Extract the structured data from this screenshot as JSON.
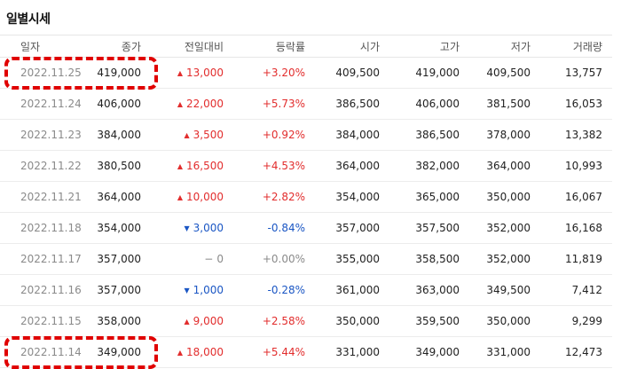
{
  "title": "일별시세",
  "columns": [
    "일자",
    "종가",
    "전일대비",
    "등락률",
    "시가",
    "고가",
    "저가",
    "거래량"
  ],
  "colors": {
    "up": "#e22d2d",
    "down": "#1a56c4",
    "flat": "#8a8a8a",
    "highlight": "#e00000"
  },
  "rows": [
    {
      "date": "2022.11.25",
      "close": "419,000",
      "dir": "up",
      "change": "13,000",
      "rate": "+3.20%",
      "open": "409,500",
      "high": "419,000",
      "low": "409,500",
      "volume": "13,757",
      "highlighted": true
    },
    {
      "date": "2022.11.24",
      "close": "406,000",
      "dir": "up",
      "change": "22,000",
      "rate": "+5.73%",
      "open": "386,500",
      "high": "406,000",
      "low": "381,500",
      "volume": "16,053",
      "highlighted": false
    },
    {
      "date": "2022.11.23",
      "close": "384,000",
      "dir": "up",
      "change": "3,500",
      "rate": "+0.92%",
      "open": "384,000",
      "high": "386,500",
      "low": "378,000",
      "volume": "13,382",
      "highlighted": false
    },
    {
      "date": "2022.11.22",
      "close": "380,500",
      "dir": "up",
      "change": "16,500",
      "rate": "+4.53%",
      "open": "364,000",
      "high": "382,000",
      "low": "364,000",
      "volume": "10,993",
      "highlighted": false
    },
    {
      "date": "2022.11.21",
      "close": "364,000",
      "dir": "up",
      "change": "10,000",
      "rate": "+2.82%",
      "open": "354,000",
      "high": "365,000",
      "low": "350,000",
      "volume": "16,067",
      "highlighted": false
    },
    {
      "date": "2022.11.18",
      "close": "354,000",
      "dir": "down",
      "change": "3,000",
      "rate": "-0.84%",
      "open": "357,000",
      "high": "357,500",
      "low": "352,000",
      "volume": "16,168",
      "highlighted": false
    },
    {
      "date": "2022.11.17",
      "close": "357,000",
      "dir": "flat",
      "change": "0",
      "rate": "+0.00%",
      "open": "355,000",
      "high": "358,500",
      "low": "352,000",
      "volume": "11,819",
      "highlighted": false
    },
    {
      "date": "2022.11.16",
      "close": "357,000",
      "dir": "down",
      "change": "1,000",
      "rate": "-0.28%",
      "open": "361,000",
      "high": "363,000",
      "low": "349,500",
      "volume": "7,412",
      "highlighted": false
    },
    {
      "date": "2022.11.15",
      "close": "358,000",
      "dir": "up",
      "change": "9,000",
      "rate": "+2.58%",
      "open": "350,000",
      "high": "359,500",
      "low": "350,000",
      "volume": "9,299",
      "highlighted": false
    },
    {
      "date": "2022.11.14",
      "close": "349,000",
      "dir": "up",
      "change": "18,000",
      "rate": "+5.44%",
      "open": "331,000",
      "high": "349,000",
      "low": "331,000",
      "volume": "12,473",
      "highlighted": true
    }
  ]
}
